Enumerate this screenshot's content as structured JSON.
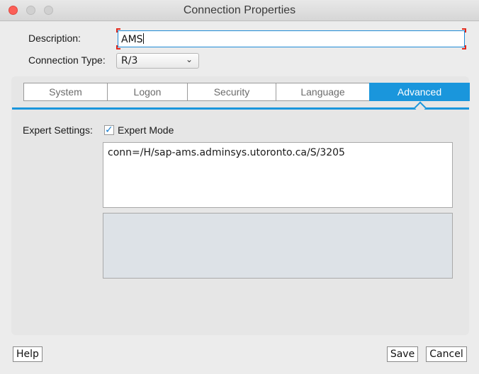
{
  "window": {
    "title": "Connection Properties"
  },
  "form": {
    "description_label": "Description:",
    "description_value": "AMS",
    "connection_type_label": "Connection Type:",
    "connection_type_value": "R/3"
  },
  "tabs": [
    {
      "label": "System"
    },
    {
      "label": "Logon"
    },
    {
      "label": "Security"
    },
    {
      "label": "Language"
    },
    {
      "label": "Advanced"
    }
  ],
  "advanced": {
    "expert_settings_label": "Expert Settings:",
    "expert_mode_label": "Expert Mode",
    "expert_mode_checked": true,
    "connection_string": "conn=/H/sap-ams.adminsys.utoronto.ca/S/3205"
  },
  "buttons": {
    "help": "Help",
    "save": "Save",
    "cancel": "Cancel"
  },
  "colors": {
    "accent": "#1a96dc",
    "close_button": "#fc5f57",
    "focus_corner": "#e0281c"
  }
}
